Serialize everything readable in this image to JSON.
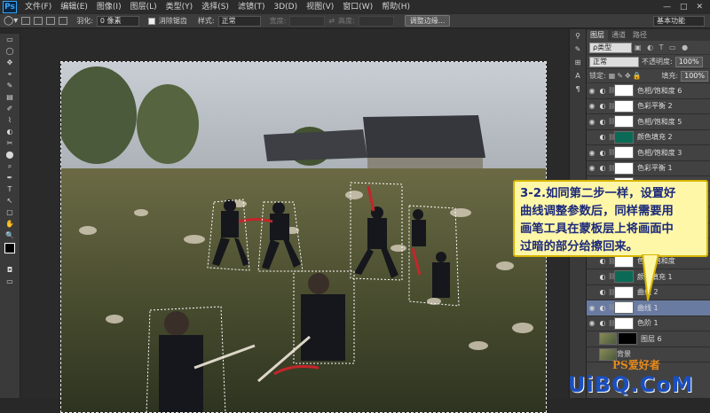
{
  "app": {
    "logo": "Ps"
  },
  "menu": [
    "文件(F)",
    "编辑(E)",
    "图像(I)",
    "图层(L)",
    "类型(Y)",
    "选择(S)",
    "滤镜(T)",
    "3D(D)",
    "视图(V)",
    "窗口(W)",
    "帮助(H)"
  ],
  "window_controls": [
    "—",
    "□",
    "✕"
  ],
  "options": {
    "feather_label": "羽化:",
    "feather_value": "0 像素",
    "antialias_label": "消除锯齿",
    "style_label": "样式:",
    "style_value": "正常",
    "width_label": "宽度:",
    "height_label": "高度:",
    "refine_button": "调整边缘...",
    "workspace": "基本功能"
  },
  "tools": [
    "▭",
    "◯",
    "✥",
    "⌖",
    "✎",
    "▤",
    "✐",
    "⌇",
    "◐",
    "✂",
    "⬤",
    "⌕",
    "✒",
    "T",
    "↖",
    "▢",
    "✋",
    "🔍"
  ],
  "panel": {
    "tabs": [
      "图层",
      "通道",
      "路径"
    ],
    "filter_label": "ρ类型",
    "blend_mode": "正常",
    "opacity_label": "不透明度:",
    "opacity_value": "100%",
    "lock_label": "锁定:",
    "fill_label": "填充:",
    "fill_value": "100%",
    "layers": [
      {
        "name": "色相/饱和度 6",
        "mask": "white",
        "visible": true
      },
      {
        "name": "色彩平衡 2",
        "mask": "white",
        "visible": true
      },
      {
        "name": "色相/饱和度 5",
        "mask": "white",
        "visible": true
      },
      {
        "name": "颜色填充 2",
        "mask": "fill",
        "visible": false
      },
      {
        "name": "色相/饱和度 3",
        "mask": "white",
        "visible": true
      },
      {
        "name": "色彩平衡 1",
        "mask": "white",
        "visible": true
      },
      {
        "name": "",
        "mask": "white",
        "visible": false
      },
      {
        "name": "",
        "mask": "white",
        "visible": false
      },
      {
        "name": "",
        "mask": "white",
        "visible": false
      },
      {
        "name": "",
        "mask": "white",
        "visible": false
      },
      {
        "name": "",
        "mask": "white",
        "visible": false
      },
      {
        "name": "色相/饱和度",
        "mask": "white",
        "visible": false
      },
      {
        "name": "颜色填充 1",
        "mask": "fill",
        "visible": false
      },
      {
        "name": "曲线 2",
        "mask": "white",
        "visible": false
      },
      {
        "name": "曲线 1",
        "mask": "white",
        "visible": true,
        "selected": true
      },
      {
        "name": "色阶 1",
        "mask": "white",
        "visible": true
      },
      {
        "name": "图层 6",
        "mask": "black",
        "visible": false,
        "thumb": true
      },
      {
        "name": "背景",
        "mask": "none",
        "visible": false,
        "thumb": true
      }
    ]
  },
  "callout": {
    "lines": [
      "3-2.如同第二步一样，设置好",
      "曲线调整参数后，同样需要用",
      "画笔工具在蒙板层上将画面中",
      "过暗的部分给擦回来。"
    ]
  },
  "watermark": {
    "site_name": "PS爱好者",
    "domain": "UiBQ.CoM"
  }
}
